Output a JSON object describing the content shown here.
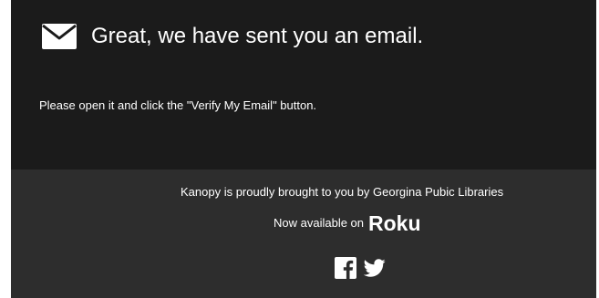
{
  "notice": {
    "icon": "envelope-icon",
    "headline": "Great, we have sent you an email.",
    "instruction": "Please open it and click the \"Verify My Email\" button."
  },
  "footer": {
    "brought_by": "Kanopy is proudly brought to you by Georgina Pubic Libraries",
    "available_on": "Now available on",
    "partner_logo": "Roku",
    "social": [
      {
        "icon": "facebook-icon"
      },
      {
        "icon": "twitter-icon"
      }
    ]
  },
  "colors": {
    "panel_background": "#1b1b1b",
    "footer_background": "#2d2d2d",
    "text": "#ffffff"
  }
}
